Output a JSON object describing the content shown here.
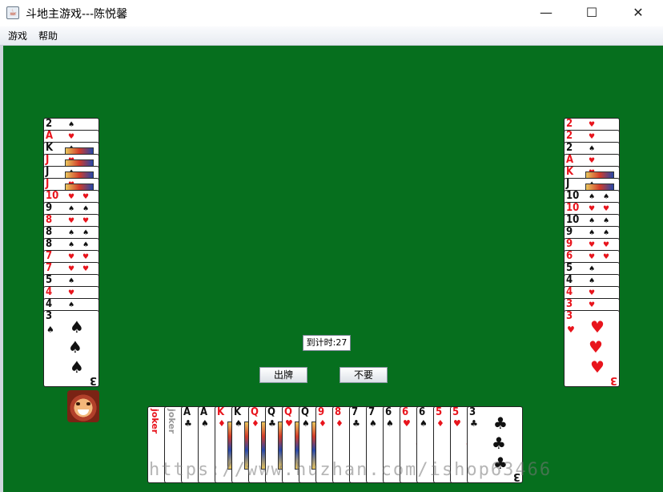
{
  "window": {
    "title": "斗地主游戏---陈悦馨",
    "controls": {
      "minimize": "—",
      "maximize": "☐",
      "close": "✕"
    }
  },
  "menu": {
    "items": [
      "游戏",
      "帮助"
    ]
  },
  "table_color": "#066f1e",
  "left_player": {
    "cards": [
      {
        "rank": "2",
        "suit": "spade"
      },
      {
        "rank": "A",
        "suit": "heart"
      },
      {
        "rank": "K",
        "suit": "spade"
      },
      {
        "rank": "J",
        "suit": "heart"
      },
      {
        "rank": "J",
        "suit": "spade"
      },
      {
        "rank": "J",
        "suit": "heart"
      },
      {
        "rank": "10",
        "suit": "heart"
      },
      {
        "rank": "9",
        "suit": "spade"
      },
      {
        "rank": "8",
        "suit": "heart"
      },
      {
        "rank": "8",
        "suit": "spade"
      },
      {
        "rank": "8",
        "suit": "spade"
      },
      {
        "rank": "7",
        "suit": "heart"
      },
      {
        "rank": "7",
        "suit": "heart"
      },
      {
        "rank": "5",
        "suit": "spade"
      },
      {
        "rank": "4",
        "suit": "heart"
      },
      {
        "rank": "4",
        "suit": "spade"
      },
      {
        "rank": "3",
        "suit": "spade"
      }
    ]
  },
  "right_player": {
    "cards": [
      {
        "rank": "2",
        "suit": "heart"
      },
      {
        "rank": "2",
        "suit": "heart"
      },
      {
        "rank": "2",
        "suit": "spade"
      },
      {
        "rank": "A",
        "suit": "heart"
      },
      {
        "rank": "K",
        "suit": "heart"
      },
      {
        "rank": "J",
        "suit": "spade"
      },
      {
        "rank": "10",
        "suit": "spade"
      },
      {
        "rank": "10",
        "suit": "heart"
      },
      {
        "rank": "10",
        "suit": "spade"
      },
      {
        "rank": "9",
        "suit": "spade"
      },
      {
        "rank": "9",
        "suit": "heart"
      },
      {
        "rank": "6",
        "suit": "heart"
      },
      {
        "rank": "5",
        "suit": "spade"
      },
      {
        "rank": "4",
        "suit": "spade"
      },
      {
        "rank": "4",
        "suit": "heart"
      },
      {
        "rank": "3",
        "suit": "heart"
      },
      {
        "rank": "3",
        "suit": "heart"
      }
    ]
  },
  "my_hand": {
    "cards": [
      {
        "rank": "joker",
        "suit": "joker-red"
      },
      {
        "rank": "joker",
        "suit": "joker-black"
      },
      {
        "rank": "A",
        "suit": "club"
      },
      {
        "rank": "A",
        "suit": "spade"
      },
      {
        "rank": "K",
        "suit": "diamond"
      },
      {
        "rank": "K",
        "suit": "spade"
      },
      {
        "rank": "Q",
        "suit": "diamond"
      },
      {
        "rank": "Q",
        "suit": "club"
      },
      {
        "rank": "Q",
        "suit": "heart"
      },
      {
        "rank": "Q",
        "suit": "spade"
      },
      {
        "rank": "9",
        "suit": "diamond"
      },
      {
        "rank": "8",
        "suit": "diamond"
      },
      {
        "rank": "7",
        "suit": "club"
      },
      {
        "rank": "7",
        "suit": "spade"
      },
      {
        "rank": "6",
        "suit": "spade"
      },
      {
        "rank": "6",
        "suit": "heart"
      },
      {
        "rank": "6",
        "suit": "spade"
      },
      {
        "rank": "5",
        "suit": "diamond"
      },
      {
        "rank": "5",
        "suit": "heart"
      },
      {
        "rank": "3",
        "suit": "club"
      }
    ]
  },
  "timer": {
    "text": "到计时:27"
  },
  "actions": {
    "play_label": "出牌",
    "pass_label": "不要"
  },
  "watermark": "https://www.huzhan.com/ishop63466"
}
